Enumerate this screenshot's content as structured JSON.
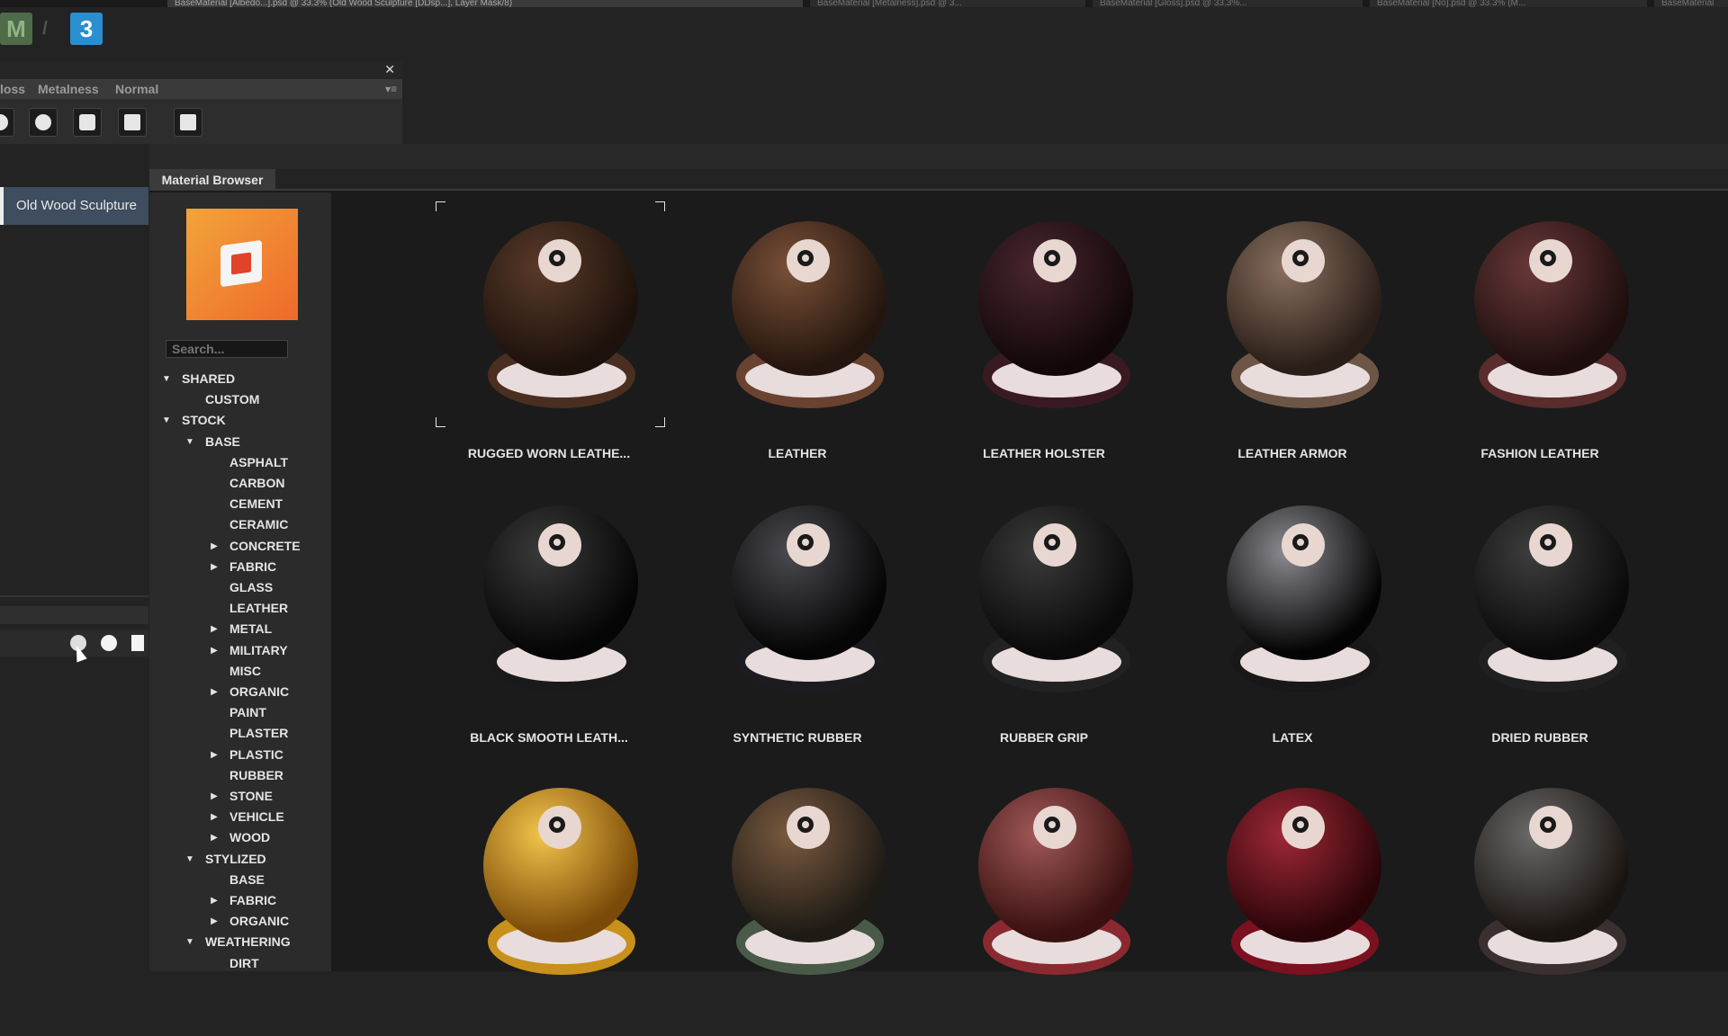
{
  "window": {
    "doc_tabs": [
      {
        "label": "BaseMaterial [Albedo...].psd @ 33.3% (Old Wood Sculpture [DDsp...], Layer Mask/8)",
        "active": true
      },
      {
        "label": "BaseMaterial [Metalness].psd @ 3...",
        "active": false
      },
      {
        "label": "BaseMaterial [Gloss].psd @ 33.3%...",
        "active": false
      },
      {
        "label": "BaseMaterial [No].psd @ 33.3% (M...",
        "active": false
      },
      {
        "label": "BaseMaterial",
        "active": false
      }
    ],
    "app_icons": [
      {
        "name": "mixer-app-icon",
        "glyph": "M",
        "bg": "#4f6b4a",
        "fg": "#8fb585"
      },
      {
        "name": "separator-icon",
        "glyph": "/",
        "bg": "transparent",
        "fg": "#555"
      },
      {
        "name": "suite-3-app-icon",
        "glyph": "3",
        "bg": "#2a8fd1",
        "fg": "#ffffff"
      }
    ]
  },
  "left_panel": {
    "tabs": [
      "loss",
      "Metalness",
      "Normal"
    ],
    "close_glyph": "✕",
    "menu_glyph": "▾≡"
  },
  "layers": {
    "selected_layer": "Old Wood Sculpture"
  },
  "browser": {
    "tab_label": "Material Browser",
    "search_placeholder": "Search...",
    "tree": [
      {
        "label": "SHARED",
        "depth": 0,
        "caret": "down"
      },
      {
        "label": "CUSTOM",
        "depth": 1,
        "caret": ""
      },
      {
        "label": "STOCK",
        "depth": 0,
        "caret": "down"
      },
      {
        "label": "BASE",
        "depth": 1,
        "caret": "down"
      },
      {
        "label": "ASPHALT",
        "depth": 2,
        "caret": ""
      },
      {
        "label": "CARBON",
        "depth": 2,
        "caret": ""
      },
      {
        "label": "CEMENT",
        "depth": 2,
        "caret": ""
      },
      {
        "label": "CERAMIC",
        "depth": 2,
        "caret": ""
      },
      {
        "label": "CONCRETE",
        "depth": 2,
        "caret": "right"
      },
      {
        "label": "FABRIC",
        "depth": 2,
        "caret": "right"
      },
      {
        "label": "GLASS",
        "depth": 2,
        "caret": ""
      },
      {
        "label": "LEATHER",
        "depth": 2,
        "caret": ""
      },
      {
        "label": "METAL",
        "depth": 2,
        "caret": "right"
      },
      {
        "label": "MILITARY",
        "depth": 2,
        "caret": "right"
      },
      {
        "label": "MISC",
        "depth": 2,
        "caret": ""
      },
      {
        "label": "ORGANIC",
        "depth": 2,
        "caret": "right"
      },
      {
        "label": "PAINT",
        "depth": 2,
        "caret": ""
      },
      {
        "label": "PLASTER",
        "depth": 2,
        "caret": ""
      },
      {
        "label": "PLASTIC",
        "depth": 2,
        "caret": "right"
      },
      {
        "label": "RUBBER",
        "depth": 2,
        "caret": ""
      },
      {
        "label": "STONE",
        "depth": 2,
        "caret": "right"
      },
      {
        "label": "VEHICLE",
        "depth": 2,
        "caret": "right"
      },
      {
        "label": "WOOD",
        "depth": 2,
        "caret": "right"
      },
      {
        "label": "STYLIZED",
        "depth": 1,
        "caret": "down"
      },
      {
        "label": "BASE",
        "depth": 2,
        "caret": ""
      },
      {
        "label": "FABRIC",
        "depth": 2,
        "caret": "right"
      },
      {
        "label": "ORGANIC",
        "depth": 2,
        "caret": "right"
      },
      {
        "label": "WEATHERING",
        "depth": 1,
        "caret": "down"
      },
      {
        "label": "DIRT",
        "depth": 2,
        "caret": ""
      }
    ],
    "materials": [
      {
        "label": "RUGGED WORN LEATHE...",
        "c1": "#5a3a2a",
        "c2": "#1c110b",
        "stand": "#4a2e20",
        "selected": true
      },
      {
        "label": "LEATHER",
        "c1": "#7a5038",
        "c2": "#24160e",
        "stand": "#6a4230",
        "selected": false
      },
      {
        "label": "LEATHER HOLSTER",
        "c1": "#4a2630",
        "c2": "#120809",
        "stand": "#3a1a22",
        "selected": false
      },
      {
        "label": "LEATHER ARMOR",
        "c1": "#8a7060",
        "c2": "#2a1e18",
        "stand": "#6e5646",
        "selected": false
      },
      {
        "label": "FASHION LEATHER",
        "c1": "#6a3838",
        "c2": "#1e0e0e",
        "stand": "#5a2c2c",
        "selected": false
      },
      {
        "label": "BLACK SMOOTH LEATH...",
        "c1": "#3a3a3a",
        "c2": "#050505",
        "stand": "#1a1a1a",
        "selected": false
      },
      {
        "label": "SYNTHETIC RUBBER",
        "c1": "#4a4a50",
        "c2": "#050505",
        "stand": "#1c1c20",
        "selected": false
      },
      {
        "label": "RUBBER GRIP",
        "c1": "#3a3a3a",
        "c2": "#0a0a0a",
        "stand": "#222",
        "selected": false
      },
      {
        "label": "LATEX",
        "c1": "#8a8a90",
        "c2": "#040404",
        "stand": "#181818",
        "selected": false
      },
      {
        "label": "DRIED RUBBER",
        "c1": "#3e3e3e",
        "c2": "#0a0a0a",
        "stand": "#202020",
        "selected": false
      },
      {
        "label": "",
        "c1": "#f2c44a",
        "c2": "#7a4a08",
        "stand": "#c8901c",
        "selected": false
      },
      {
        "label": "",
        "c1": "#7a5a40",
        "c2": "#1e1a14",
        "stand": "#4a5a48",
        "selected": false
      },
      {
        "label": "",
        "c1": "#a05858",
        "c2": "#3a1010",
        "stand": "#8a2a30",
        "selected": false
      },
      {
        "label": "",
        "c1": "#a02838",
        "c2": "#2a0508",
        "stand": "#7a1020",
        "selected": false
      },
      {
        "label": "",
        "c1": "#6a6a6a",
        "c2": "#1a1410",
        "stand": "#3a3030",
        "selected": false
      }
    ]
  }
}
